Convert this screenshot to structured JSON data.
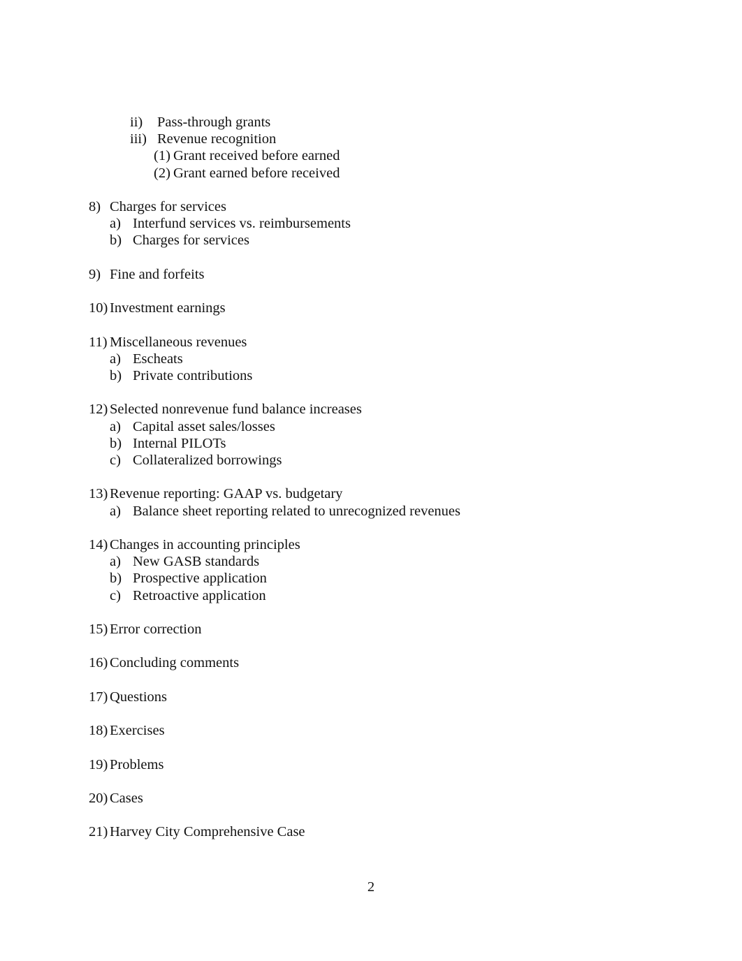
{
  "document": {
    "page_number": "2",
    "blocks": [
      {
        "type": "items",
        "items": [
          {
            "level": 3,
            "marker": "ii)",
            "label": "Pass-through grants"
          },
          {
            "level": 3,
            "marker": "iii)",
            "label": "Revenue recognition"
          },
          {
            "level": 4,
            "marker": "(1)",
            "label": "Grant received before earned"
          },
          {
            "level": 4,
            "marker": "(2)",
            "label": "Grant earned before received"
          }
        ]
      },
      {
        "type": "spacer"
      },
      {
        "type": "items",
        "items": [
          {
            "level": 1,
            "marker": "8)",
            "label": "Charges for services"
          },
          {
            "level": 2,
            "marker": "a)",
            "label": "Interfund services vs. reimbursements"
          },
          {
            "level": 2,
            "marker": "b)",
            "label": "Charges for services"
          }
        ]
      },
      {
        "type": "spacer"
      },
      {
        "type": "items",
        "items": [
          {
            "level": 1,
            "marker": "9)",
            "label": "Fine and forfeits"
          }
        ]
      },
      {
        "type": "spacer"
      },
      {
        "type": "items",
        "items": [
          {
            "level": 1,
            "marker": "10)",
            "label": "Investment earnings"
          }
        ]
      },
      {
        "type": "spacer"
      },
      {
        "type": "items",
        "items": [
          {
            "level": 1,
            "marker": "11)",
            "label": "Miscellaneous revenues"
          },
          {
            "level": 2,
            "marker": "a)",
            "label": "Escheats"
          },
          {
            "level": 2,
            "marker": "b)",
            "label": "Private contributions"
          }
        ]
      },
      {
        "type": "spacer"
      },
      {
        "type": "items",
        "items": [
          {
            "level": 1,
            "marker": "12)",
            "label": "Selected nonrevenue fund balance increases"
          },
          {
            "level": 2,
            "marker": "a)",
            "label": "Capital asset sales/losses"
          },
          {
            "level": 2,
            "marker": "b)",
            "label": "Internal PILOTs"
          },
          {
            "level": 2,
            "marker": "c)",
            "label": "Collateralized borrowings"
          }
        ]
      },
      {
        "type": "spacer"
      },
      {
        "type": "items",
        "items": [
          {
            "level": 1,
            "marker": "13)",
            "label": "Revenue reporting: GAAP vs. budgetary"
          },
          {
            "level": 2,
            "marker": "a)",
            "label": "Balance sheet reporting related to unrecognized revenues"
          }
        ]
      },
      {
        "type": "spacer"
      },
      {
        "type": "items",
        "items": [
          {
            "level": 1,
            "marker": "14)",
            "label": "Changes in accounting principles"
          },
          {
            "level": 2,
            "marker": "a)",
            "label": "New GASB standards"
          },
          {
            "level": 2,
            "marker": "b)",
            "label": "Prospective application"
          },
          {
            "level": 2,
            "marker": "c)",
            "label": "Retroactive application"
          }
        ]
      },
      {
        "type": "spacer"
      },
      {
        "type": "items",
        "items": [
          {
            "level": 1,
            "marker": "15)",
            "label": "Error correction"
          }
        ]
      },
      {
        "type": "spacer"
      },
      {
        "type": "items",
        "items": [
          {
            "level": 1,
            "marker": "16)",
            "label": "Concluding comments"
          }
        ]
      },
      {
        "type": "spacer"
      },
      {
        "type": "items",
        "items": [
          {
            "level": 1,
            "marker": "17)",
            "label": "Questions"
          }
        ]
      },
      {
        "type": "spacer"
      },
      {
        "type": "items",
        "items": [
          {
            "level": 1,
            "marker": "18)",
            "label": "Exercises"
          }
        ]
      },
      {
        "type": "spacer"
      },
      {
        "type": "items",
        "items": [
          {
            "level": 1,
            "marker": "19)",
            "label": "Problems"
          }
        ]
      },
      {
        "type": "spacer"
      },
      {
        "type": "items",
        "items": [
          {
            "level": 1,
            "marker": "20)",
            "label": "Cases"
          }
        ]
      },
      {
        "type": "spacer"
      },
      {
        "type": "items",
        "items": [
          {
            "level": 1,
            "marker": "21)",
            "label": "Harvey City Comprehensive Case"
          }
        ]
      }
    ]
  }
}
